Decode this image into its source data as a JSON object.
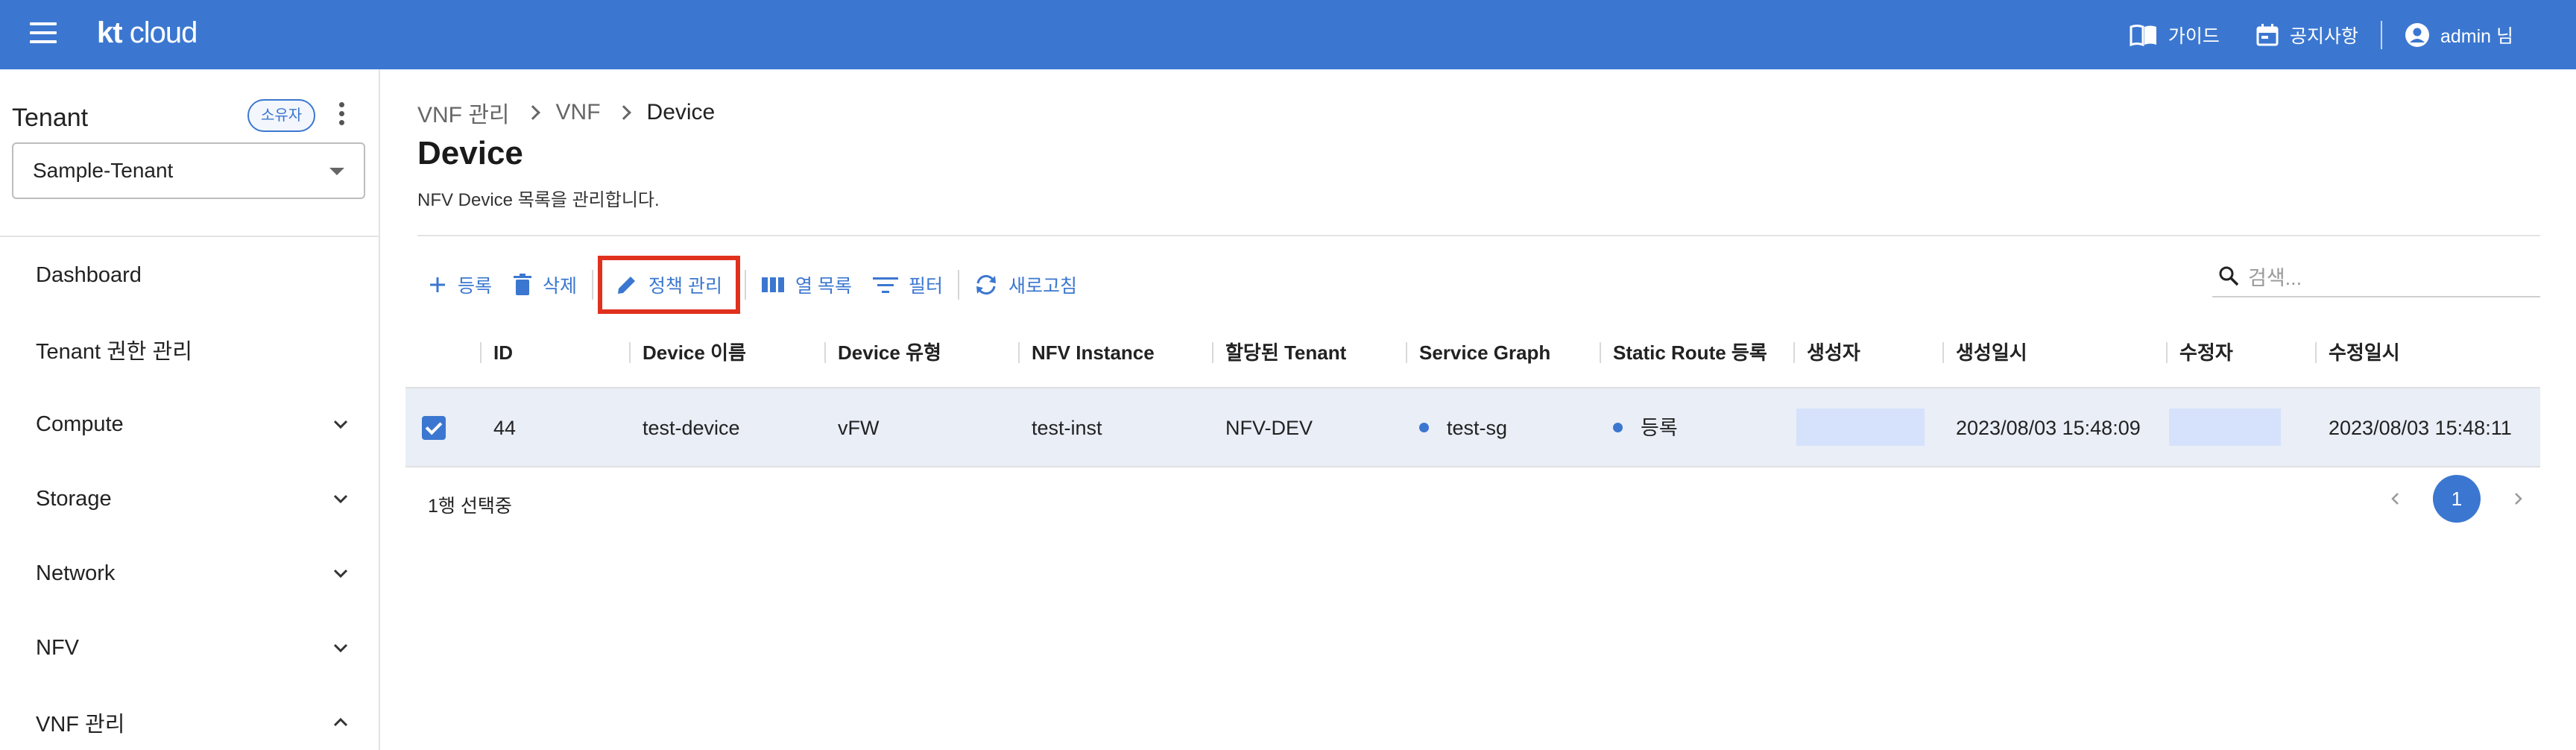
{
  "header": {
    "logo_kt": "kt",
    "logo_cloud": "cloud",
    "guide_label": "가이드",
    "notice_label": "공지사항",
    "user_label": "admin 님",
    "bg_color": "#3b77d0"
  },
  "sidebar": {
    "tenant_label": "Tenant",
    "owner_badge": "소유자",
    "tenant_selected": "Sample-Tenant",
    "items": [
      {
        "label": "Dashboard"
      },
      {
        "label": "Tenant 권한 관리"
      },
      {
        "label": "Compute"
      },
      {
        "label": "Storage"
      },
      {
        "label": "Network"
      },
      {
        "label": "NFV"
      },
      {
        "label": "VNF 관리"
      }
    ]
  },
  "breadcrumb": [
    "VNF 관리",
    "VNF",
    "Device"
  ],
  "page": {
    "title": "Device",
    "description": "NFV Device 목록을 관리합니다."
  },
  "toolbar": {
    "register": "등록",
    "delete": "삭제",
    "policy": "정책 관리",
    "columns": "열 목록",
    "filter": "필터",
    "refresh": "새로고침",
    "search_placeholder": "검색..."
  },
  "table": {
    "headers": [
      "ID",
      "Device 이름",
      "Device 유형",
      "NFV Instance",
      "할당된 Tenant",
      "Service Graph",
      "Static Route 등록",
      "생성자",
      "생성일시",
      "수정자",
      "수정일시"
    ],
    "rows": [
      {
        "id": "44",
        "name": "test-device",
        "type": "vFW",
        "instance": "test-inst",
        "tenant": "NFV-DEV",
        "service_graph": "test-sg",
        "static_route": "등록",
        "creator": "",
        "created_at": "2023/08/03 15:48:09",
        "modifier": "",
        "modified_at": "2023/08/03 15:48:11",
        "selected": true
      }
    ]
  },
  "footer": {
    "selected_text": "1행 선택중",
    "current_page": "1"
  }
}
